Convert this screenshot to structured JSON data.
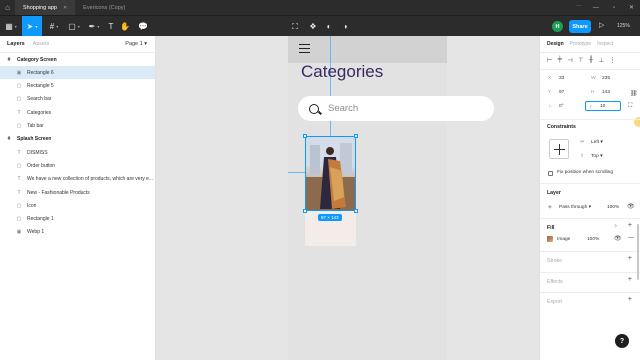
{
  "titlebar": {
    "tabs": [
      {
        "label": "Shopping app",
        "active": true
      },
      {
        "label": "Evericons (Copy)",
        "active": false
      }
    ]
  },
  "toolbar": {
    "avatar_initial": "H",
    "share_label": "Share",
    "zoom": "125%"
  },
  "left_panel": {
    "tab_layers": "Layers",
    "tab_assets": "Assets",
    "page": "Page 1",
    "layers": [
      {
        "label": "Category Screen",
        "icon": "frame-icon",
        "glyph": "#",
        "kind": "frame",
        "selected": false
      },
      {
        "label": "Rectangle 6",
        "icon": "image-icon",
        "glyph": "▣",
        "kind": "child",
        "selected": true
      },
      {
        "label": "Rectangle 5",
        "icon": "rectangle-icon",
        "glyph": "▢",
        "kind": "child",
        "selected": false
      },
      {
        "label": "Search bar",
        "icon": "rectangle-icon",
        "glyph": "▢",
        "kind": "child",
        "selected": false
      },
      {
        "label": "Categories",
        "icon": "text-icon",
        "glyph": "T",
        "kind": "child",
        "selected": false
      },
      {
        "label": "Tab bar",
        "icon": "rectangle-icon",
        "glyph": "▢",
        "kind": "child",
        "selected": false
      },
      {
        "label": "Splash Screen",
        "icon": "frame-icon",
        "glyph": "#",
        "kind": "frame",
        "selected": false
      },
      {
        "label": "DISMISS",
        "icon": "text-icon",
        "glyph": "T",
        "kind": "child",
        "selected": false
      },
      {
        "label": "Order button",
        "icon": "rectangle-icon",
        "glyph": "▢",
        "kind": "child",
        "selected": false
      },
      {
        "label": "We have a new collection of products, which are very e...",
        "icon": "text-icon",
        "glyph": "T",
        "kind": "child",
        "selected": false
      },
      {
        "label": "New - Fashionable Products",
        "icon": "text-icon",
        "glyph": "T",
        "kind": "child",
        "selected": false
      },
      {
        "label": "Icon",
        "icon": "rectangle-icon",
        "glyph": "▢",
        "kind": "child",
        "selected": false
      },
      {
        "label": "Rectangle 1",
        "icon": "rectangle-icon",
        "glyph": "▢",
        "kind": "child",
        "selected": false
      },
      {
        "label": "Webp 1",
        "icon": "image-icon",
        "glyph": "▣",
        "kind": "child",
        "selected": false
      }
    ]
  },
  "canvas": {
    "title": "Categories",
    "search_placeholder": "Search",
    "selection_size": "97 × 143"
  },
  "right_panel": {
    "tabs": [
      "Design",
      "Prototype",
      "Inspect"
    ],
    "props": {
      "x_key": "X",
      "x": "33",
      "y_key": "Y",
      "y": "97",
      "w_key": "W",
      "w": "235",
      "h_key": "H",
      "h": "143",
      "rotation": "0°",
      "radius": "10"
    },
    "constraints_title": "Constraints",
    "constraint_h": "Left",
    "constraint_v": "Top",
    "fix_position": "Fix position when scrolling",
    "layer_title": "Layer",
    "blend": "Pass through",
    "layer_opacity": "100%",
    "fill_title": "Fill",
    "fill_type": "Image",
    "fill_opacity": "100%",
    "stroke_title": "Stroke",
    "effects_title": "Effects",
    "export_title": "Export",
    "help": "?"
  }
}
